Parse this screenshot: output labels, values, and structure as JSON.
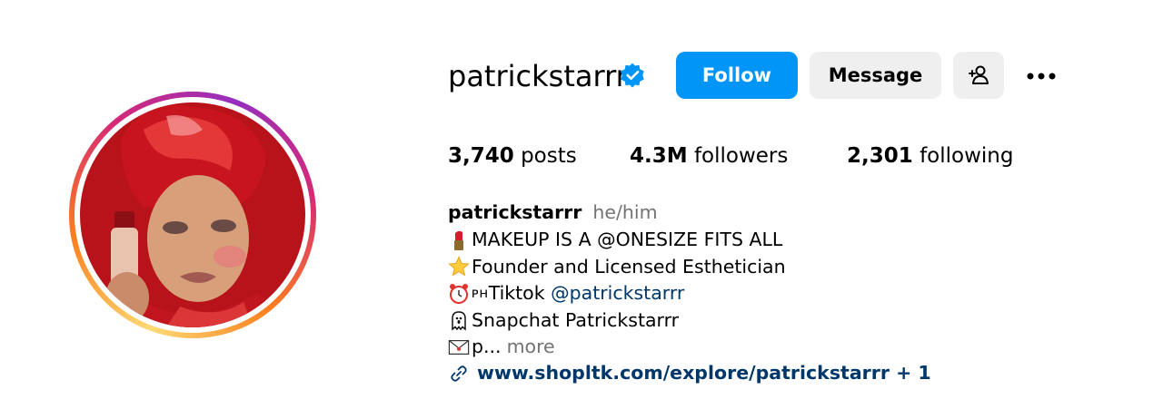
{
  "profile": {
    "username": "patrickstarrr",
    "verified": true,
    "follow_label": "Follow",
    "message_label": "Message",
    "suggest_icon": "add-person-icon",
    "more_icon": "more-horizontal-icon"
  },
  "stats": {
    "posts_count": "3,740",
    "posts_label": "posts",
    "followers_count": "4.3M",
    "followers_label": "followers",
    "following_count": "2,301",
    "following_label": "following"
  },
  "bio": {
    "name": "patrickstarrr",
    "pronouns": "he/him",
    "line1": "MAKEUP IS A @ONESIZE FITS ALL",
    "line1_icon": "lipstick-icon",
    "line2": "Founder and Licensed Esthetician",
    "line2_icon": "star-icon",
    "line3_prefix": "ᴘʜ",
    "line3_text": "Tiktok ",
    "line3_mention": "@patrickstarrr",
    "line3_icon": "alarm-clock-icon",
    "line4": "Snapchat Patrickstarrr",
    "line4_icon": "ghost-icon",
    "line5": "p...",
    "line5_icon": "envelope-icon",
    "more_label": "more",
    "link": "www.shopltk.com/explore/patrickstarrr + 1",
    "link_icon": "link-icon"
  },
  "colors": {
    "accent": "#0095f6",
    "secondary_button": "#efefef",
    "link": "#00376b",
    "muted": "#737373"
  }
}
